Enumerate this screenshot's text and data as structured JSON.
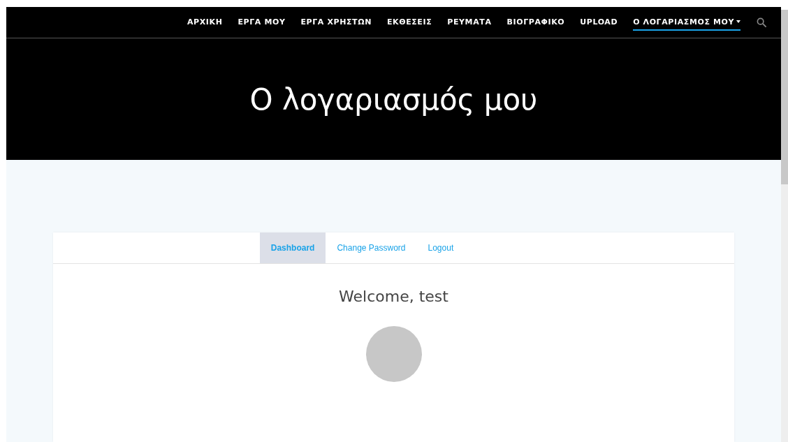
{
  "nav": {
    "items": [
      {
        "label": "ΑΡΧΙΚΗ",
        "selected": false,
        "dropdown": false
      },
      {
        "label": "ΕΡΓΑ ΜΟΥ",
        "selected": false,
        "dropdown": false
      },
      {
        "label": "ΕΡΓΑ ΧΡΗΣΤΩΝ",
        "selected": false,
        "dropdown": false
      },
      {
        "label": "ΕΚΘΕΣΕΙΣ",
        "selected": false,
        "dropdown": false
      },
      {
        "label": "ΡΕΥΜΑΤΑ",
        "selected": false,
        "dropdown": false
      },
      {
        "label": "ΒΙΟΓΡΑΦΙΚΟ",
        "selected": false,
        "dropdown": false
      },
      {
        "label": "UPLOAD",
        "selected": false,
        "dropdown": false
      },
      {
        "label": "Ο ΛΟΓΑΡΙΑΣΜΟΣ ΜΟΥ",
        "selected": true,
        "dropdown": true
      }
    ]
  },
  "hero": {
    "title": "Ο λογαριασμός μου"
  },
  "account": {
    "tabs": [
      {
        "label": "Dashboard",
        "selected": true
      },
      {
        "label": "Change Password",
        "selected": false
      },
      {
        "label": "Logout",
        "selected": false
      }
    ],
    "welcome": "Welcome, test"
  }
}
